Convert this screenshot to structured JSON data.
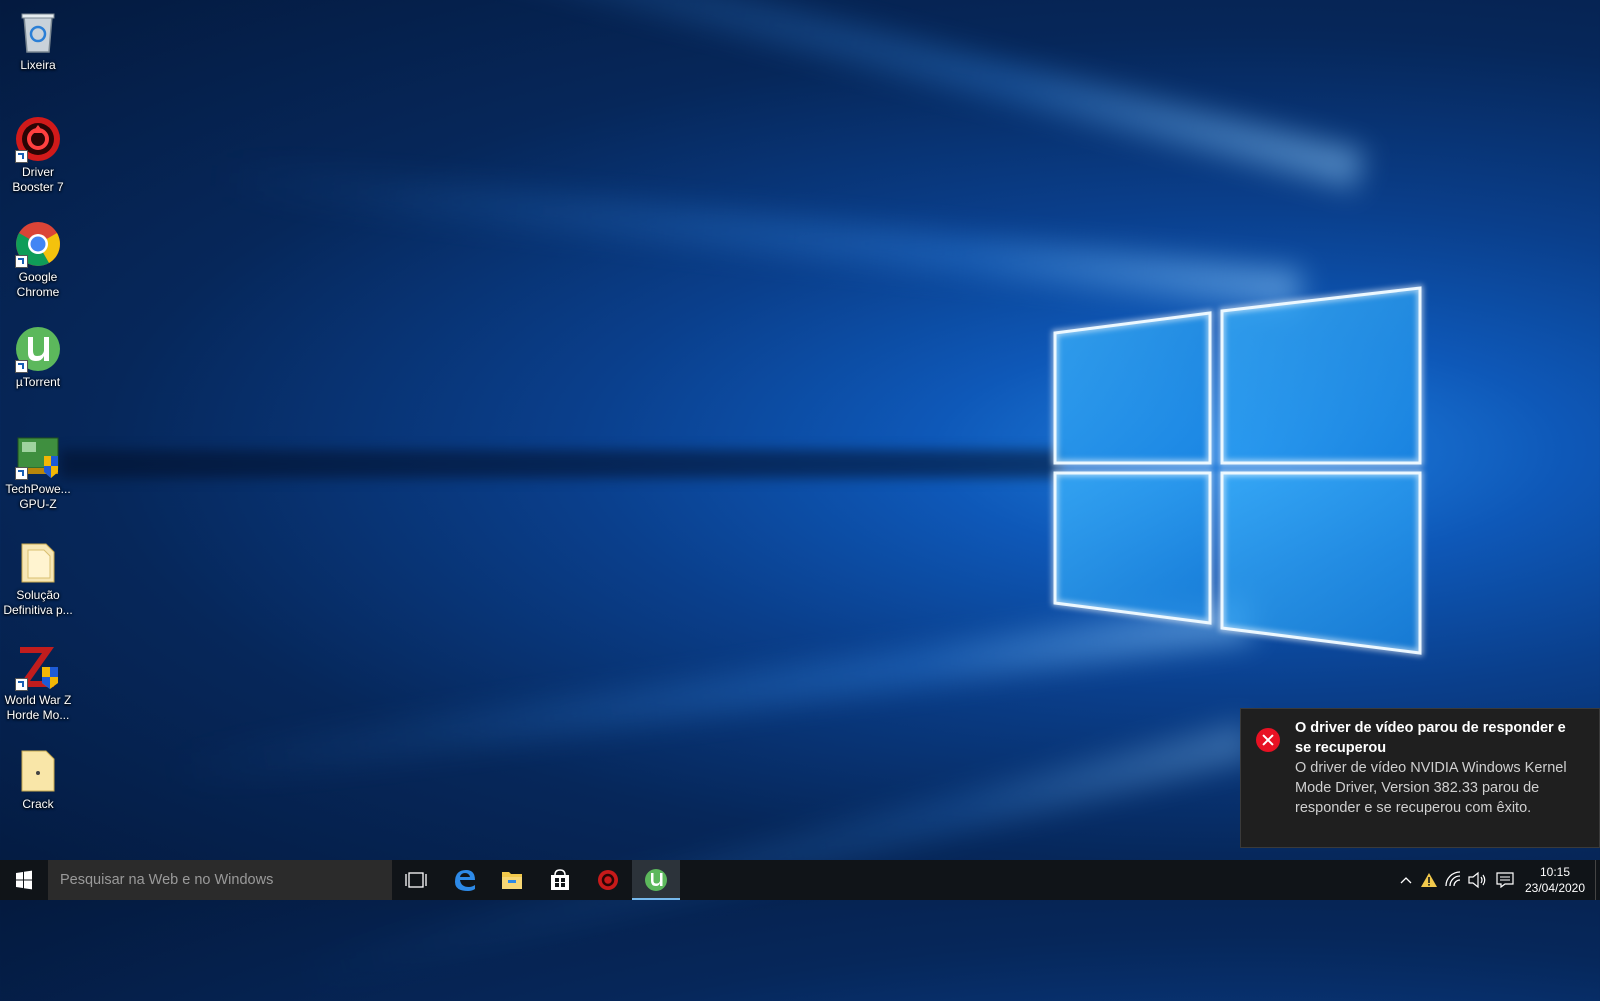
{
  "desktop": {
    "icons": [
      {
        "label": "Lixeira"
      },
      {
        "label": "Driver Booster 7"
      },
      {
        "label": "Google Chrome"
      },
      {
        "label": "µTorrent"
      },
      {
        "label": "TechPowe... GPU-Z"
      },
      {
        "label": "Solução Definitiva p..."
      },
      {
        "label": "World War Z Horde Mo..."
      },
      {
        "label": "Crack"
      }
    ]
  },
  "notification": {
    "title": "O driver de vídeo parou de responder e se recuperou",
    "body": "O driver de vídeo NVIDIA Windows Kernel Mode Driver, Version 382.33 parou de responder e se recuperou com êxito.",
    "icon": "error-icon",
    "accent": "#e81123"
  },
  "taskbar": {
    "search_placeholder": "Pesquisar na Web e no Windows",
    "pinned": [
      "task-view-icon",
      "edge-icon",
      "file-explorer-icon",
      "store-icon",
      "driver-booster-icon",
      "utorrent-icon"
    ],
    "active_app": "utorrent-icon",
    "clock": {
      "time": "10:15",
      "date": "23/04/2020"
    }
  },
  "colors": {
    "taskbar": "#101418",
    "toast": "#1f1f1f",
    "active_indicator": "#76b9ed"
  }
}
